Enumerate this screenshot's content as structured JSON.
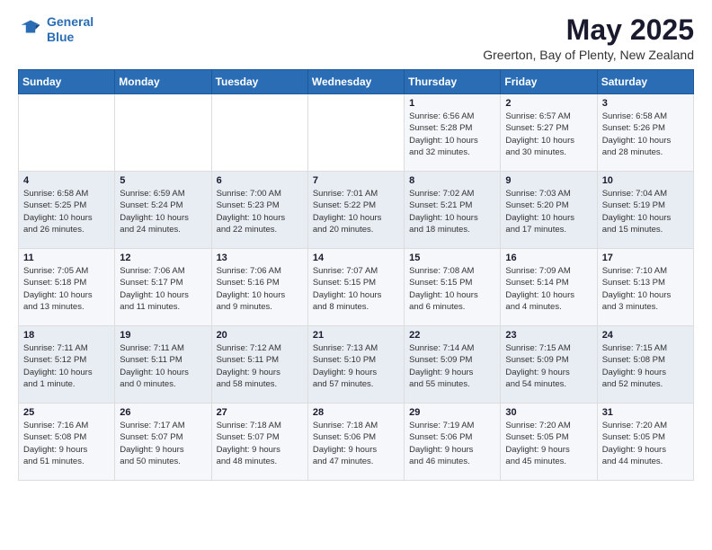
{
  "logo": {
    "line1": "General",
    "line2": "Blue"
  },
  "title": "May 2025",
  "subtitle": "Greerton, Bay of Plenty, New Zealand",
  "days_of_week": [
    "Sunday",
    "Monday",
    "Tuesday",
    "Wednesday",
    "Thursday",
    "Friday",
    "Saturday"
  ],
  "weeks": [
    [
      {
        "day": "",
        "info": ""
      },
      {
        "day": "",
        "info": ""
      },
      {
        "day": "",
        "info": ""
      },
      {
        "day": "",
        "info": ""
      },
      {
        "day": "1",
        "info": "Sunrise: 6:56 AM\nSunset: 5:28 PM\nDaylight: 10 hours\nand 32 minutes."
      },
      {
        "day": "2",
        "info": "Sunrise: 6:57 AM\nSunset: 5:27 PM\nDaylight: 10 hours\nand 30 minutes."
      },
      {
        "day": "3",
        "info": "Sunrise: 6:58 AM\nSunset: 5:26 PM\nDaylight: 10 hours\nand 28 minutes."
      }
    ],
    [
      {
        "day": "4",
        "info": "Sunrise: 6:58 AM\nSunset: 5:25 PM\nDaylight: 10 hours\nand 26 minutes."
      },
      {
        "day": "5",
        "info": "Sunrise: 6:59 AM\nSunset: 5:24 PM\nDaylight: 10 hours\nand 24 minutes."
      },
      {
        "day": "6",
        "info": "Sunrise: 7:00 AM\nSunset: 5:23 PM\nDaylight: 10 hours\nand 22 minutes."
      },
      {
        "day": "7",
        "info": "Sunrise: 7:01 AM\nSunset: 5:22 PM\nDaylight: 10 hours\nand 20 minutes."
      },
      {
        "day": "8",
        "info": "Sunrise: 7:02 AM\nSunset: 5:21 PM\nDaylight: 10 hours\nand 18 minutes."
      },
      {
        "day": "9",
        "info": "Sunrise: 7:03 AM\nSunset: 5:20 PM\nDaylight: 10 hours\nand 17 minutes."
      },
      {
        "day": "10",
        "info": "Sunrise: 7:04 AM\nSunset: 5:19 PM\nDaylight: 10 hours\nand 15 minutes."
      }
    ],
    [
      {
        "day": "11",
        "info": "Sunrise: 7:05 AM\nSunset: 5:18 PM\nDaylight: 10 hours\nand 13 minutes."
      },
      {
        "day": "12",
        "info": "Sunrise: 7:06 AM\nSunset: 5:17 PM\nDaylight: 10 hours\nand 11 minutes."
      },
      {
        "day": "13",
        "info": "Sunrise: 7:06 AM\nSunset: 5:16 PM\nDaylight: 10 hours\nand 9 minutes."
      },
      {
        "day": "14",
        "info": "Sunrise: 7:07 AM\nSunset: 5:15 PM\nDaylight: 10 hours\nand 8 minutes."
      },
      {
        "day": "15",
        "info": "Sunrise: 7:08 AM\nSunset: 5:15 PM\nDaylight: 10 hours\nand 6 minutes."
      },
      {
        "day": "16",
        "info": "Sunrise: 7:09 AM\nSunset: 5:14 PM\nDaylight: 10 hours\nand 4 minutes."
      },
      {
        "day": "17",
        "info": "Sunrise: 7:10 AM\nSunset: 5:13 PM\nDaylight: 10 hours\nand 3 minutes."
      }
    ],
    [
      {
        "day": "18",
        "info": "Sunrise: 7:11 AM\nSunset: 5:12 PM\nDaylight: 10 hours\nand 1 minute."
      },
      {
        "day": "19",
        "info": "Sunrise: 7:11 AM\nSunset: 5:11 PM\nDaylight: 10 hours\nand 0 minutes."
      },
      {
        "day": "20",
        "info": "Sunrise: 7:12 AM\nSunset: 5:11 PM\nDaylight: 9 hours\nand 58 minutes."
      },
      {
        "day": "21",
        "info": "Sunrise: 7:13 AM\nSunset: 5:10 PM\nDaylight: 9 hours\nand 57 minutes."
      },
      {
        "day": "22",
        "info": "Sunrise: 7:14 AM\nSunset: 5:09 PM\nDaylight: 9 hours\nand 55 minutes."
      },
      {
        "day": "23",
        "info": "Sunrise: 7:15 AM\nSunset: 5:09 PM\nDaylight: 9 hours\nand 54 minutes."
      },
      {
        "day": "24",
        "info": "Sunrise: 7:15 AM\nSunset: 5:08 PM\nDaylight: 9 hours\nand 52 minutes."
      }
    ],
    [
      {
        "day": "25",
        "info": "Sunrise: 7:16 AM\nSunset: 5:08 PM\nDaylight: 9 hours\nand 51 minutes."
      },
      {
        "day": "26",
        "info": "Sunrise: 7:17 AM\nSunset: 5:07 PM\nDaylight: 9 hours\nand 50 minutes."
      },
      {
        "day": "27",
        "info": "Sunrise: 7:18 AM\nSunset: 5:07 PM\nDaylight: 9 hours\nand 48 minutes."
      },
      {
        "day": "28",
        "info": "Sunrise: 7:18 AM\nSunset: 5:06 PM\nDaylight: 9 hours\nand 47 minutes."
      },
      {
        "day": "29",
        "info": "Sunrise: 7:19 AM\nSunset: 5:06 PM\nDaylight: 9 hours\nand 46 minutes."
      },
      {
        "day": "30",
        "info": "Sunrise: 7:20 AM\nSunset: 5:05 PM\nDaylight: 9 hours\nand 45 minutes."
      },
      {
        "day": "31",
        "info": "Sunrise: 7:20 AM\nSunset: 5:05 PM\nDaylight: 9 hours\nand 44 minutes."
      }
    ]
  ]
}
